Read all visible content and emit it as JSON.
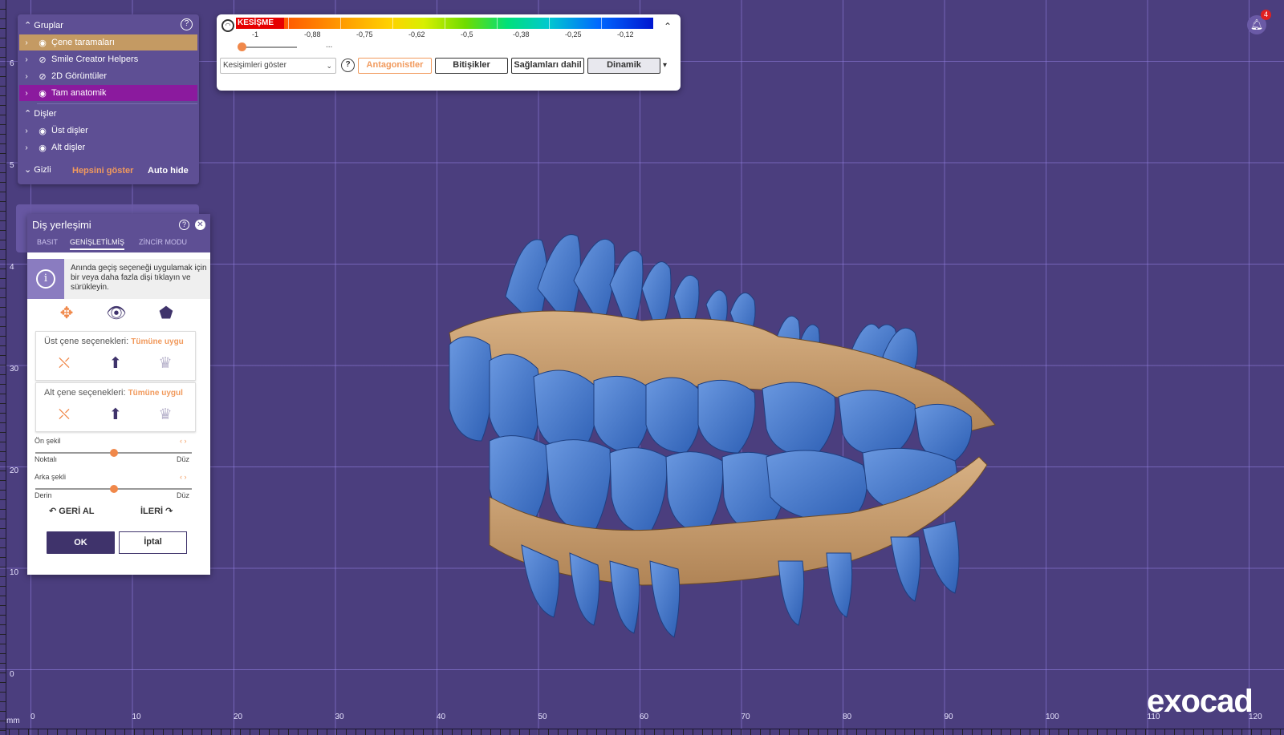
{
  "viewport": {
    "x_ticks": [
      "0",
      "10",
      "20",
      "30",
      "40",
      "50",
      "60",
      "70",
      "80",
      "90",
      "100",
      "110",
      "120"
    ],
    "y_ticks": [
      "6",
      "5",
      "4",
      "30",
      "20",
      "10",
      "0"
    ],
    "unit": "mm"
  },
  "groups_panel": {
    "groups_header": "Gruplar",
    "group_items": [
      {
        "label": "Çene taramaları"
      },
      {
        "label": "Smile Creator Helpers"
      },
      {
        "label": "2D Görüntüler"
      },
      {
        "label": "Tam anatomik"
      }
    ],
    "teeth_header": "Dişler",
    "teeth_items": [
      {
        "label": "Üst dişler"
      },
      {
        "label": "Alt dişler"
      }
    ],
    "hidden_header": "Gizli",
    "show_all": "Hepsini göster",
    "auto_hide": "Auto hide"
  },
  "intersection_toolbar": {
    "color_bar_title": "KESİŞME",
    "scale_labels": [
      "-1",
      "-0,88",
      "-0,75",
      "-0,62",
      "-0,5",
      "-0,38",
      "-0,25",
      "-0,12"
    ],
    "slider_dots": "...",
    "show_select_value": "Kesişimleri göster",
    "buttons": {
      "antagonists": "Antagonistler",
      "adjacent": "Bitişikler",
      "restorations": "Sağlamları dahil",
      "dynamic": "Dinamik"
    }
  },
  "notification": {
    "count": "4"
  },
  "tooth_placement": {
    "title": "Diş yerleşimi",
    "tabs": [
      "BASIT",
      "GENİŞLETİLMİŞ",
      "ZİNCİR MODU"
    ],
    "info_text": "Anında geçiş seçeneği uygulamak için bir veya daha fazla dişi tıklayın ve sürükleyin.",
    "upper_jaw_label": "Üst çene seçenekleri:",
    "upper_jaw_apply": "Tümüne uygu",
    "lower_jaw_label": "Alt çene seçenekleri:",
    "lower_jaw_apply": "Tümüne uygul",
    "front_shape": {
      "title": "Ön şekil",
      "low": "Noktalı",
      "high": "Düz",
      "value": 0.5
    },
    "back_shape": {
      "title": "Arka şekli",
      "low": "Derin",
      "high": "Düz",
      "value": 0.5
    },
    "undo": "GERİ AL",
    "redo": "İLERİ",
    "ok": "OK",
    "cancel": "İptal"
  },
  "brand": {
    "logo": "exocad"
  }
}
